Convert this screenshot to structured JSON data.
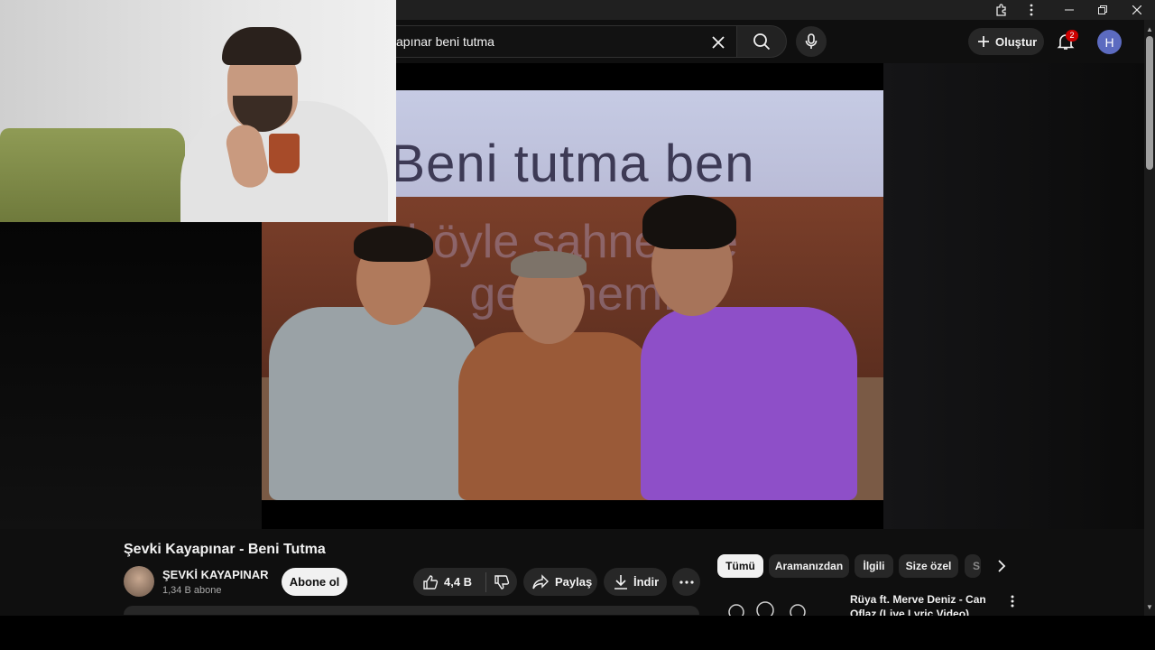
{
  "masthead": {
    "search_query": "apınar beni tutma",
    "create_label": "Oluştur",
    "notification_count": "2",
    "avatar_letter": "H"
  },
  "video": {
    "lyric_line1": "Beni tutma ben",
    "lyric_line2": "böyle sahnelere",
    "lyric_line3": "gelemem."
  },
  "watch": {
    "title": "Şevki Kayapınar - Beni Tutma",
    "channel_name": "ŞEVKİ KAYAPINAR",
    "subscribers": "1,34 B abone",
    "subscribe_label": "Abone ol",
    "likes": "4,4 B",
    "share_label": "Paylaş",
    "download_label": "İndir"
  },
  "chips": [
    {
      "label": "Tümü",
      "active": true
    },
    {
      "label": "Aramanızdan",
      "active": false
    },
    {
      "label": "İlgili",
      "active": false
    },
    {
      "label": "Size özel",
      "active": false
    },
    {
      "label": "S",
      "active": false
    }
  ],
  "recommendation": {
    "title": "Rüya ft. Merve Deniz - Can Oflaz (Live Lyric Video)"
  },
  "icons": {
    "extensions": "puzzle-icon",
    "menu": "kebab-icon",
    "minimize": "minimize-icon",
    "restore": "restore-icon",
    "close": "close-icon"
  },
  "colors": {
    "background": "#0f0f0f",
    "chip_active": "#f1f1f1",
    "badge": "#cc0000",
    "avatar": "#5c6bc0"
  }
}
